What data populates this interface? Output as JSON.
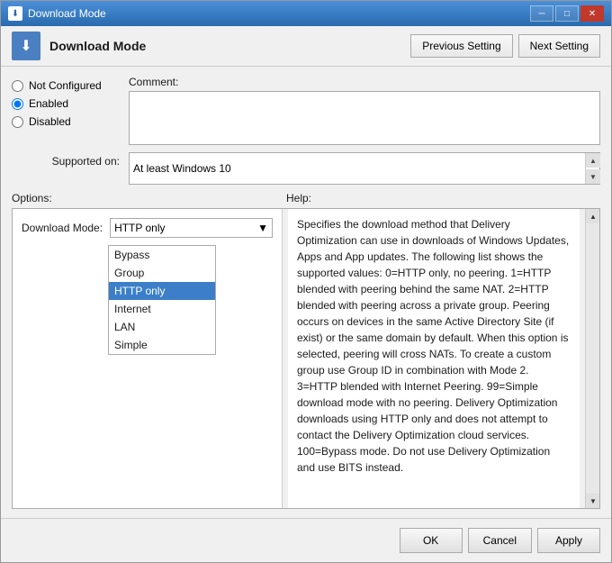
{
  "window": {
    "title": "Download Mode",
    "icon": "⬇"
  },
  "titlebar": {
    "minimize": "─",
    "maximize": "□",
    "close": "✕"
  },
  "header": {
    "title": "Download Mode",
    "prev_button": "Previous Setting",
    "next_button": "Next Setting"
  },
  "radio": {
    "not_configured": "Not Configured",
    "enabled": "Enabled",
    "disabled": "Disabled",
    "selected": "enabled"
  },
  "comment": {
    "label": "Comment:",
    "value": ""
  },
  "supported": {
    "label": "Supported on:",
    "value": "At least Windows 10"
  },
  "sections": {
    "options_label": "Options:",
    "help_label": "Help:"
  },
  "download_mode": {
    "label": "Download Mode:",
    "current_value": "HTTP only",
    "options": [
      "Bypass",
      "Group",
      "HTTP only",
      "Internet",
      "LAN",
      "Simple"
    ],
    "selected_option": "HTTP only"
  },
  "help_text": "Specifies the download method that Delivery Optimization can use in downloads of Windows Updates, Apps and App updates. The following list shows the supported values: 0=HTTP only, no peering. 1=HTTP blended with peering behind the same NAT. 2=HTTP blended with peering across a private group. Peering occurs on devices in the same Active Directory Site (if exist) or the same domain by default. When this option is selected, peering will cross NATs. To create a custom group use Group ID in combination with Mode 2. 3=HTTP blended with Internet Peering. 99=Simple download mode with no peering. Delivery Optimization downloads using HTTP only and does not attempt to contact the Delivery Optimization cloud services. 100=Bypass mode. Do not use Delivery Optimization and use BITS instead.",
  "footer": {
    "ok": "OK",
    "cancel": "Cancel",
    "apply": "Apply"
  }
}
